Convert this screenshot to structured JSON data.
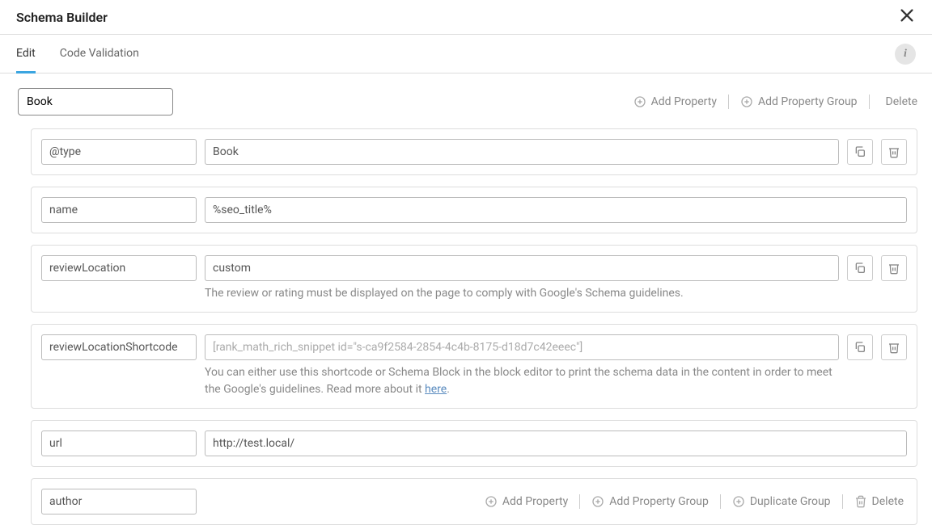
{
  "header": {
    "title": "Schema Builder"
  },
  "tabs": {
    "edit": "Edit",
    "code": "Code Validation"
  },
  "topActions": {
    "addProperty": "Add Property",
    "addPropertyGroup": "Add Property Group",
    "delete": "Delete"
  },
  "schemaType": "Book",
  "properties": [
    {
      "key": "@type",
      "value": "Book",
      "hasActions": true
    },
    {
      "key": "name",
      "value": "%seo_title%",
      "hasActions": false
    },
    {
      "key": "reviewLocation",
      "value": "custom",
      "hasActions": true,
      "help": "The review or rating must be displayed on the page to comply with Google's Schema guidelines."
    },
    {
      "key": "reviewLocationShortcode",
      "value": "",
      "placeholder": "[rank_math_rich_snippet id=\"s-ca9f2584-2854-4c4b-8175-d18d7c42eeec\"]",
      "hasActions": true,
      "help": "You can either use this shortcode or Schema Block in the block editor to print the schema data in the content in order to meet the Google's guidelines. Read more about it ",
      "linkText": "here",
      "helpAfter": "."
    },
    {
      "key": "url",
      "value": "http://test.local/",
      "hasActions": false
    }
  ],
  "group": {
    "key": "author",
    "actions": {
      "addProperty": "Add Property",
      "addPropertyGroup": "Add Property Group",
      "duplicateGroup": "Duplicate Group",
      "delete": "Delete"
    }
  }
}
